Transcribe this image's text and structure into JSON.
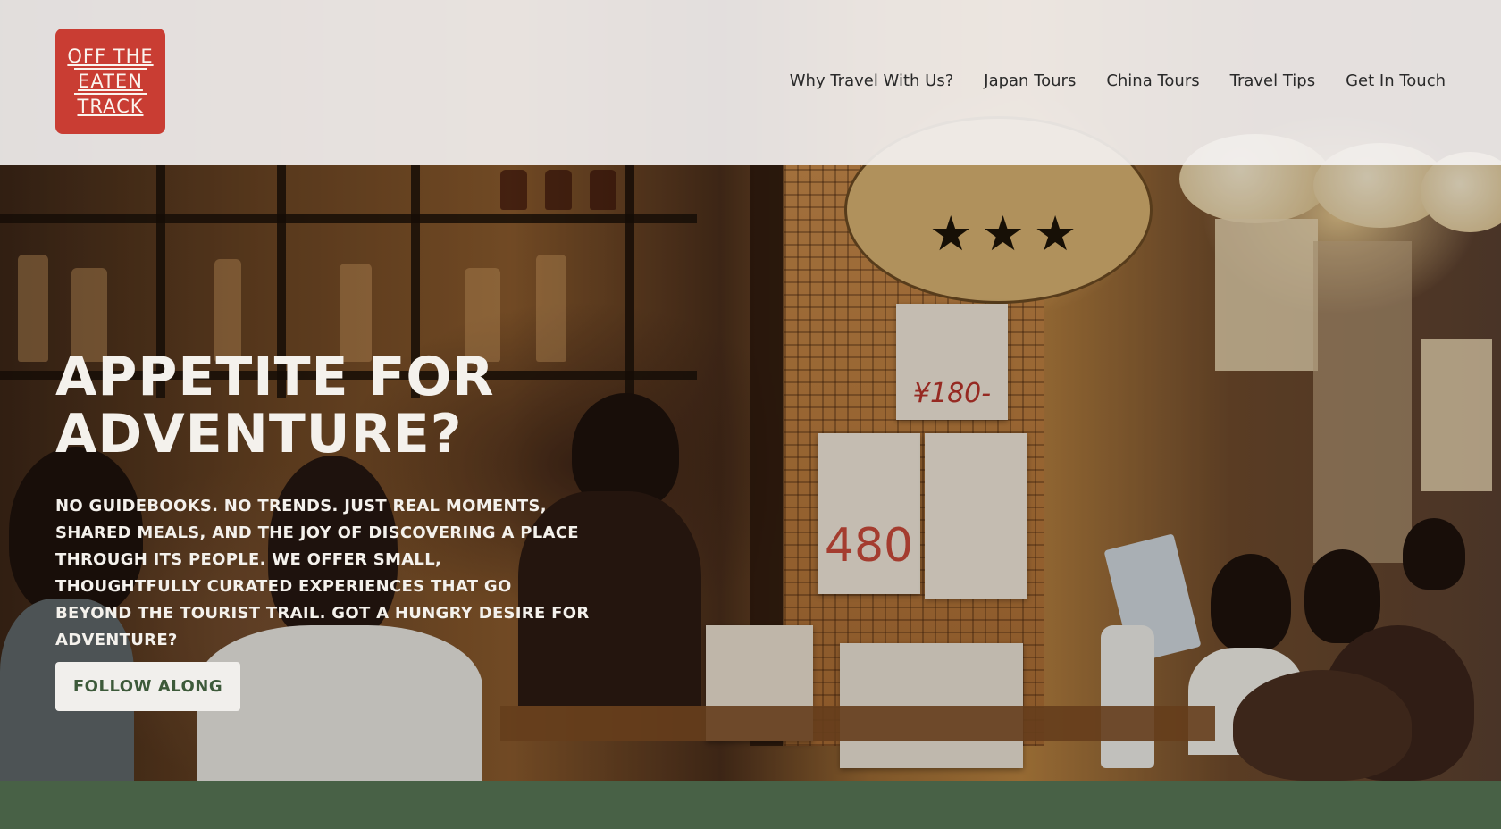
{
  "logo": {
    "line1": "OFF THE",
    "line2": "EATEN",
    "line3": "TRACK",
    "color": "#c93d33"
  },
  "nav": {
    "items": [
      {
        "label": "Why Travel With Us?"
      },
      {
        "label": "Japan Tours"
      },
      {
        "label": "China Tours"
      },
      {
        "label": "Travel Tips"
      },
      {
        "label": "Get In Touch"
      }
    ]
  },
  "hero": {
    "title_line1": "APPETITE FOR",
    "title_line2": "ADVENTURE?",
    "description": "NO GUIDEBOOKS. NO TRENDS. JUST REAL MOMENTS, SHARED MEALS, AND THE JOY OF DISCOVERING A PLACE THROUGH ITS PEOPLE. WE OFFER SMALL, THOUGHTFULLY CURATED EXPERIENCES THAT GO BEYOND THE TOURIST TRAIL. GOT A HUNGRY DESIRE FOR ADVENTURE?",
    "cta_label": "FOLLOW ALONG",
    "image_signs": {
      "price_ginkgo": "¥180-",
      "price_scallop": "480"
    }
  },
  "colors": {
    "accent_green": "#486146",
    "header_bg": "#f5f3f3",
    "hero_text": "#f4f1ec"
  }
}
